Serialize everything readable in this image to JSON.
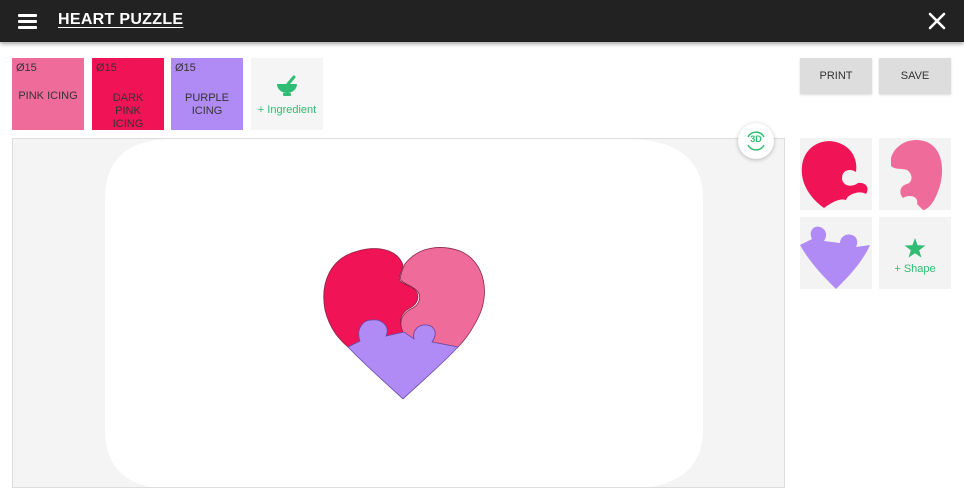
{
  "app": {
    "title": "HEART PUZZLE",
    "accent_color": "#2ebd72",
    "topbar_color": "#222222"
  },
  "ingredients": [
    {
      "diameter": "Ø15",
      "name": "PINK ICING",
      "color": "#ef6c9a"
    },
    {
      "diameter": "Ø15",
      "name": "DARK PINK ICING",
      "color": "#f01457"
    },
    {
      "diameter": "Ø15",
      "name": "PURPLE ICING",
      "color": "#b18bf5"
    }
  ],
  "add_ingredient": {
    "label": "+ Ingredient",
    "icon": "mortar-pestle-icon"
  },
  "toolbar": {
    "print_label": "PRINT",
    "save_label": "SAVE"
  },
  "view_toggle": {
    "label": "3D"
  },
  "shapes": [
    {
      "name": "dark-pink-heart-piece",
      "color": "#f01457"
    },
    {
      "name": "pink-heart-piece",
      "color": "#ef6c9a"
    },
    {
      "name": "purple-heart-piece",
      "color": "#b18bf5"
    }
  ],
  "add_shape": {
    "label": "+ Shape",
    "icon": "star-icon"
  }
}
